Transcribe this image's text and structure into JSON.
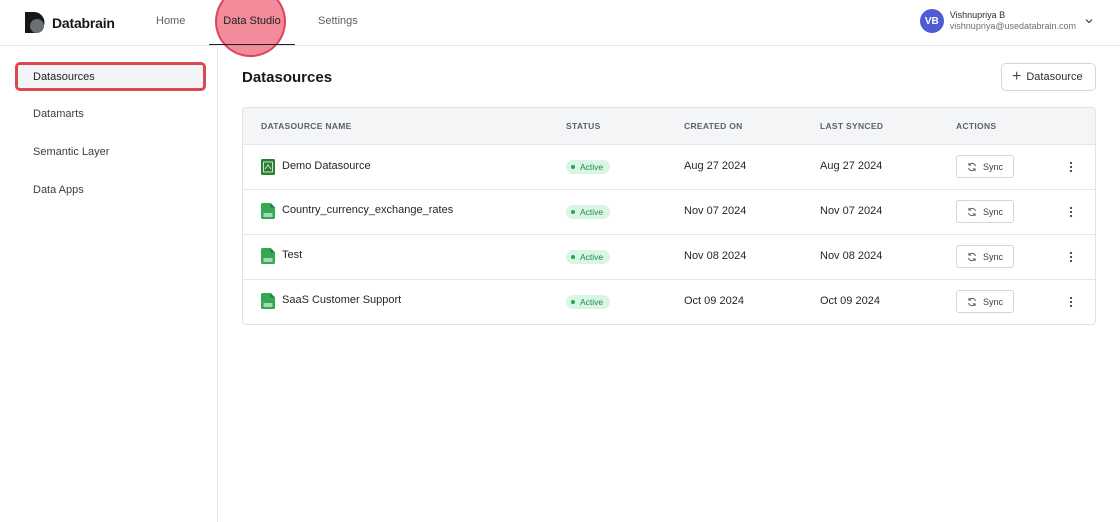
{
  "brand": {
    "name": "Databrain"
  },
  "nav": {
    "home": "Home",
    "data_studio": "Data Studio",
    "settings": "Settings"
  },
  "user": {
    "initials": "VB",
    "name": "Vishnupriya B",
    "email": "vishnupriya@usedatabrain.com"
  },
  "sidebar": {
    "items": [
      {
        "label": "Datasources",
        "active": true
      },
      {
        "label": "Datamarts"
      },
      {
        "label": "Semantic Layer"
      },
      {
        "label": "Data Apps"
      }
    ]
  },
  "page": {
    "title": "Datasources",
    "add_button": "Datasource"
  },
  "table": {
    "columns": [
      "DATASOURCE NAME",
      "STATUS",
      "CREATED ON",
      "LAST SYNCED",
      "ACTIONS"
    ],
    "rows": [
      {
        "name": "Demo Datasource",
        "icon": "database-icon",
        "status": "Active",
        "created": "Aug 27 2024",
        "synced": "Aug 27 2024",
        "action": "Sync"
      },
      {
        "name": "Country_currency_exchange_rates",
        "icon": "csv-file-icon",
        "status": "Active",
        "created": "Nov 07 2024",
        "synced": "Nov 07 2024",
        "action": "Sync"
      },
      {
        "name": "Test",
        "icon": "csv-file-icon",
        "status": "Active",
        "created": "Nov 08 2024",
        "synced": "Nov 08 2024",
        "action": "Sync"
      },
      {
        "name": "SaaS Customer Support",
        "icon": "csv-file-icon",
        "status": "Active",
        "created": "Oct 09 2024",
        "synced": "Oct 09 2024",
        "action": "Sync"
      }
    ]
  },
  "colors": {
    "accent_active_badge": "#d9f5e3",
    "avatar": "#4f5bd5",
    "highlight": "#d84a4f"
  }
}
